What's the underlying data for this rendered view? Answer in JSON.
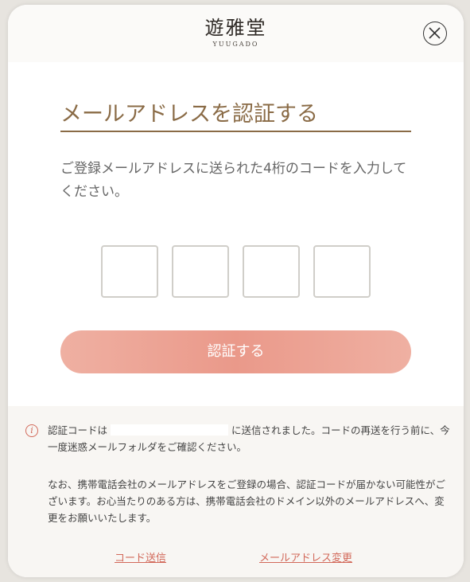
{
  "header": {
    "logo_kanji": "遊雅堂",
    "logo_roman": "YUUGADO",
    "close_icon": "close-icon"
  },
  "main": {
    "title": "メールアドレスを認証する",
    "description": "ご登録メールアドレスに送られた4桁のコードを入力してください。",
    "code_boxes": [
      "",
      "",
      "",
      ""
    ],
    "submit_label": "認証する"
  },
  "footer": {
    "notice_prefix": "認証コードは",
    "notice_suffix": "に送信されました。コードの再送を行う前に、今一度迷惑メールフォルダをご確認ください。",
    "carrier_note": "なお、携帯電話会社のメールアドレスをご登録の場合、認証コードが届かない可能性がございます。お心当たりのある方は、携帯電話会社のドメイン以外のメールアドレスへ、変更をお願いいたします。",
    "resend_link": "コード送信",
    "change_email_link": "メールアドレス変更",
    "info_icon": "info-icon"
  },
  "colors": {
    "accent_brown": "#8a6b46",
    "button_salmon": "#ea998a",
    "link_red": "#d2695a"
  }
}
